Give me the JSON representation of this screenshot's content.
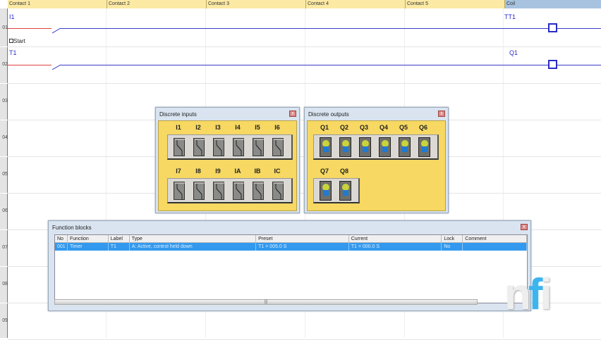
{
  "header": {
    "columns": [
      "Contact 1",
      "Contact 2",
      "Contact 3",
      "Contact 4",
      "Contact 5",
      "Coil"
    ]
  },
  "rows": [
    "01",
    "02",
    "03",
    "04",
    "05",
    "06",
    "07",
    "08",
    "09"
  ],
  "rungs": [
    {
      "contact": "I1",
      "comment": "Start",
      "coil": "TT1"
    },
    {
      "contact": "T1",
      "comment": "",
      "coil": "Q1"
    }
  ],
  "discrete_inputs": {
    "title": "Discrete inputs",
    "close": "x",
    "row1": [
      "I1",
      "I2",
      "I3",
      "I4",
      "I5",
      "I6"
    ],
    "row2": [
      "I7",
      "I8",
      "I9",
      "IA",
      "IB",
      "IC"
    ]
  },
  "discrete_outputs": {
    "title": "Discrete outputs",
    "close": "x",
    "row1": [
      "Q1",
      "Q2",
      "Q3",
      "Q4",
      "Q5",
      "Q6"
    ],
    "row2": [
      "Q7",
      "Q8"
    ]
  },
  "function_blocks": {
    "title": "Function blocks",
    "close": "x",
    "columns": [
      "No",
      "Function",
      "Label",
      "Type",
      "Preset",
      "Current",
      "Lock",
      "Comment"
    ],
    "rows": [
      [
        "001",
        "Timer",
        "T1",
        "A: Active, control held down",
        "T1 = 005.0 S",
        "T1 = 000.0 S",
        "No",
        ""
      ]
    ],
    "scroll_grip": "|||"
  },
  "logo": {
    "text": "nfi"
  },
  "colors": {
    "rung": "#3a3ac8",
    "header": "#fbe9a4",
    "coil_header": "#a7c3e0",
    "panel": "#f6d862",
    "selection": "#3399ee"
  }
}
